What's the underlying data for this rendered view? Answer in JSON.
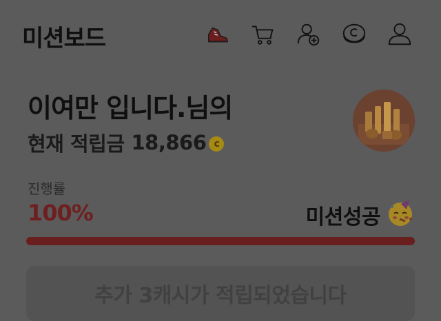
{
  "header": {
    "title": "미션보드",
    "icons": [
      "sneaker-icon",
      "cart-icon",
      "add-friend-icon",
      "cash-icon",
      "profile-icon"
    ]
  },
  "user": {
    "greeting": "이여만 입니다.님의",
    "points_label": "현재 적립금",
    "points_value": "18,866",
    "coin_symbol": "c"
  },
  "progress": {
    "label": "진행률",
    "value": "100%",
    "percent": 100,
    "status": "미션성공"
  },
  "notice": {
    "text": "추가 3캐시가 적립되었습니다"
  },
  "colors": {
    "background": "#5b5b5b",
    "progress_fill": "#6a1f1f",
    "coin": "#a68a14"
  }
}
